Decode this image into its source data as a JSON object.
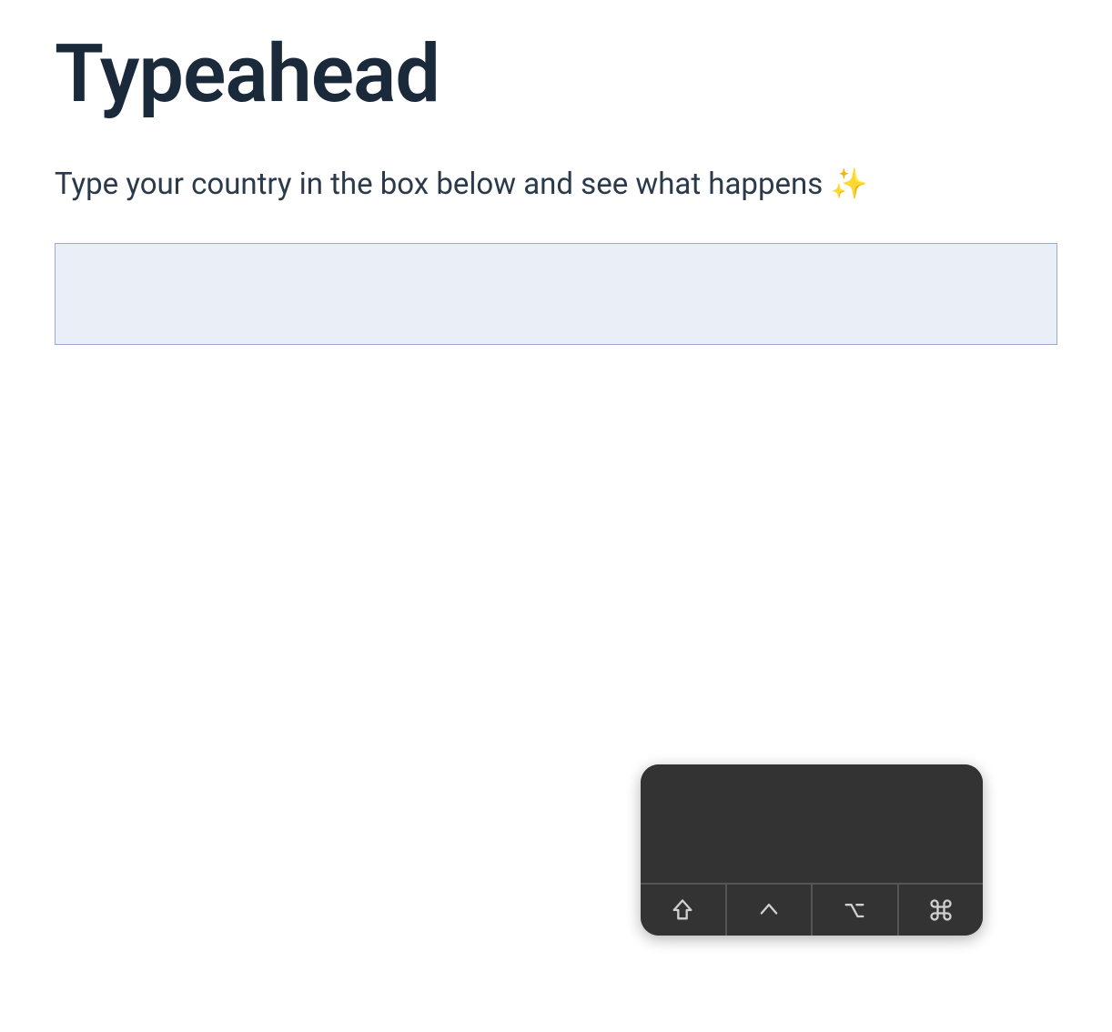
{
  "header": {
    "title": "Typeahead"
  },
  "instruction": {
    "text": "Type your country in the box below and see what happens ",
    "emoji": "✨"
  },
  "input": {
    "value": "",
    "placeholder": ""
  },
  "modifier_keys": {
    "shift": "⇧",
    "control": "^",
    "option": "⌥",
    "command": "⌘"
  }
}
